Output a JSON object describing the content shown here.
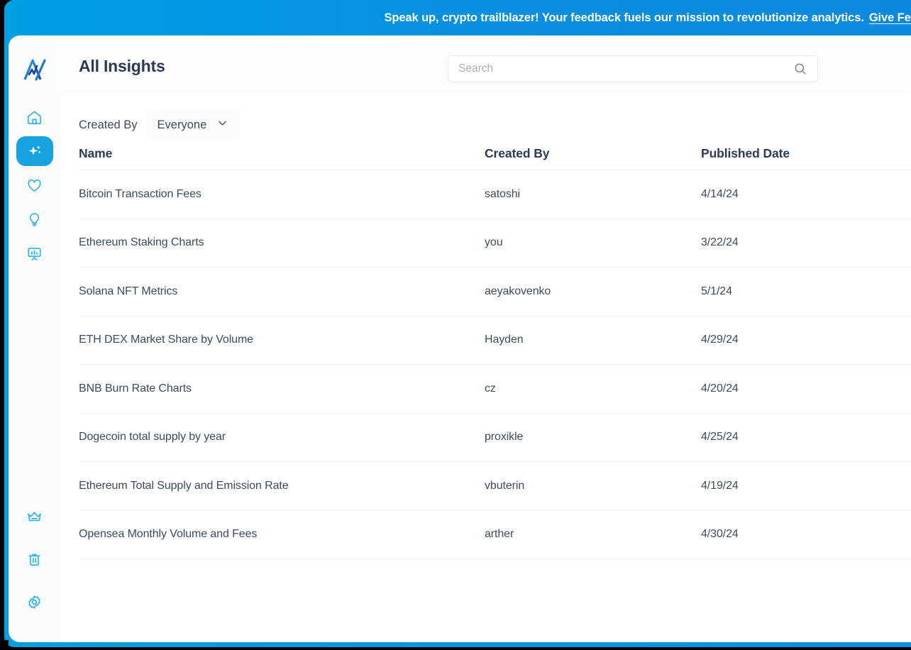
{
  "banner": {
    "message": "Speak up, crypto trailblazer! Your feedback fuels our mission to revolutionize analytics.",
    "link_label": "Give Feedback",
    "gradient_start": "#00a0e3",
    "gradient_end": "#0b89df"
  },
  "sidebar": {
    "logo_name": "amberdata-logo",
    "top_items": [
      {
        "icon": "home-icon",
        "label": "Home",
        "active": false
      },
      {
        "icon": "sparkle-icon",
        "label": "Insights",
        "active": true
      },
      {
        "icon": "heart-icon",
        "label": "Favorites",
        "active": false
      },
      {
        "icon": "lightbulb-icon",
        "label": "Ideas",
        "active": false
      },
      {
        "icon": "presentation-chart-icon",
        "label": "Dashboards",
        "active": false
      }
    ],
    "bottom_items": [
      {
        "icon": "crown-icon",
        "label": "Upgrade",
        "active": false
      },
      {
        "icon": "trash-icon",
        "label": "Trash",
        "active": false
      },
      {
        "icon": "gear-icon",
        "label": "Settings",
        "active": false
      }
    ],
    "accent_color": "#16a3e0"
  },
  "header": {
    "title": "All Insights"
  },
  "search": {
    "placeholder": "Search",
    "value": "",
    "icon": "search-icon"
  },
  "filter": {
    "label": "Created By",
    "selected": "Everyone",
    "chevron": "chevron-down-icon"
  },
  "table": {
    "columns": [
      "Name",
      "Created By",
      "Published Date"
    ],
    "rows": [
      {
        "name": "Bitcoin Transaction Fees",
        "created_by": "satoshi",
        "published_date": "4/14/24"
      },
      {
        "name": "Ethereum Staking Charts",
        "created_by": "you",
        "published_date": "3/22/24"
      },
      {
        "name": "Solana NFT Metrics",
        "created_by": "aeyakovenko",
        "published_date": "5/1/24"
      },
      {
        "name": "ETH DEX Market Share by Volume",
        "created_by": "Hayden",
        "published_date": "4/29/24"
      },
      {
        "name": "BNB Burn Rate Charts",
        "created_by": "cz",
        "published_date": "4/20/24"
      },
      {
        "name": "Dogecoin total supply by year",
        "created_by": "proxikle",
        "published_date": "4/25/24"
      },
      {
        "name": "Ethereum Total Supply and Emission Rate",
        "created_by": "vbuterin",
        "published_date": "4/19/24"
      },
      {
        "name": "Opensea Monthly Volume and Fees",
        "created_by": "arther",
        "published_date": "4/30/24"
      }
    ]
  },
  "colors": {
    "text_dark": "#2b3a55",
    "text_body": "#3f4a60",
    "brand_blue": "#16a3e0",
    "border": "#eef0f4"
  }
}
